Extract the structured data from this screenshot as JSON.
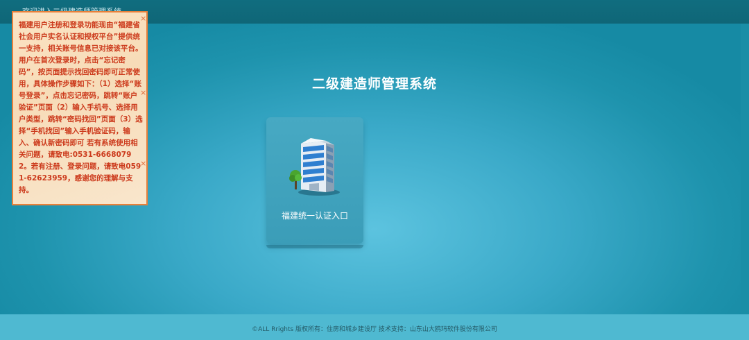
{
  "header": {
    "welcome_text": "欢迎进入二级建造师管理系统"
  },
  "main": {
    "system_title": "二级建造师管理系统",
    "entry": {
      "label": "福建统一认证入口",
      "icon": "building-icon"
    }
  },
  "notice": {
    "text": "福建用户注册和登录功能现由“福建省社会用户实名认证和授权平台”提供统一支持，相关账号信息已对接该平台。用户在首次登录时，点击“忘记密码”，按页面提示找回密码即可正常使用，具体操作步骤如下：（1）选择“账号登录”，点击忘记密码，跳转“账户验证”页面（2）输入手机号、选择用户类型，跳转“密码找回”页面（3）选择“手机找回”输入手机验证码，输入、确认新密码即可 若有系统使用相关问题，请致电:0531-66680792。若有注册、登录问题，请致电0591-62623959，感谢您的理解与支持。",
    "close_symbol": "×"
  },
  "footer": {
    "text": "©ALL Rrights  版权所有：住房和城乡建设厅    技术支持：山东山大鸥玛软件股份有限公司"
  },
  "colors": {
    "topbar": "#0f6677",
    "background": "#3aa9c8",
    "notice_border": "#e8803a",
    "notice_text": "#cc3a1c",
    "footer": "#4fb9d1"
  }
}
